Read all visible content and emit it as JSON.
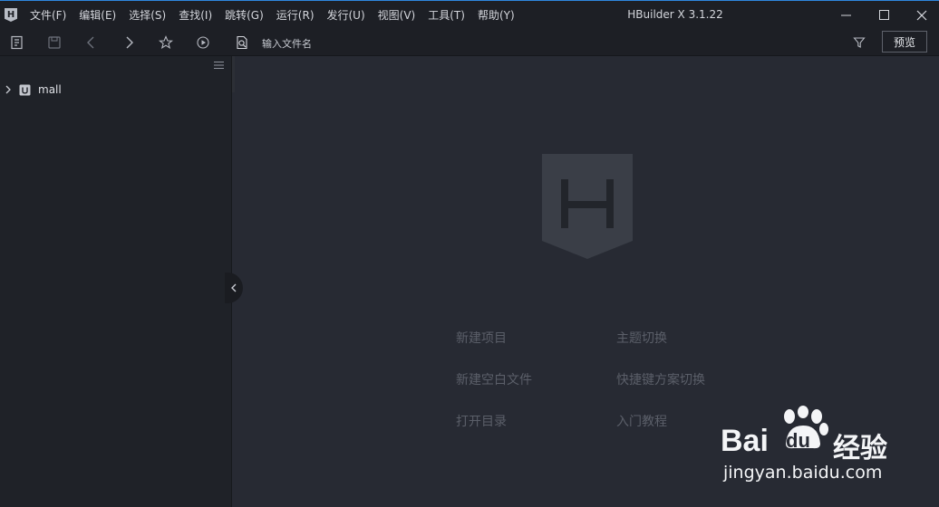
{
  "window": {
    "title": "HBuilder X 3.1.22",
    "accent": "#2e86de"
  },
  "menu": {
    "items": [
      "文件(F)",
      "编辑(E)",
      "选择(S)",
      "查找(I)",
      "跳转(G)",
      "运行(R)",
      "发行(U)",
      "视图(V)",
      "工具(T)",
      "帮助(Y)"
    ]
  },
  "toolbar": {
    "search_placeholder": "输入文件名",
    "preview_label": "预览",
    "icons": [
      "new-file-icon",
      "save-icon",
      "back-icon",
      "forward-icon",
      "star-icon",
      "run-icon",
      "file-search-icon",
      "filter-icon"
    ]
  },
  "sidebar": {
    "projects": [
      {
        "name": "mall",
        "icon": "uniapp-project-icon"
      }
    ]
  },
  "welcome": {
    "links": [
      "新建项目",
      "主题切换",
      "新建空白文件",
      "快捷键方案切换",
      "打开目录",
      "入门教程"
    ]
  },
  "watermark": {
    "brand": "Bai",
    "brand2": "du",
    "suffix": "经验",
    "url": "jingyan.baidu.com"
  }
}
